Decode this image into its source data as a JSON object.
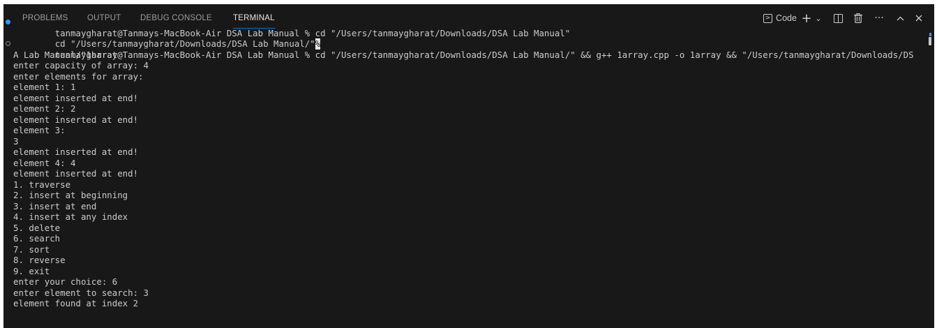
{
  "panel": {
    "tabs": [
      {
        "label": "PROBLEMS",
        "active": false
      },
      {
        "label": "OUTPUT",
        "active": false
      },
      {
        "label": "DEBUG CONSOLE",
        "active": false
      },
      {
        "label": "TERMINAL",
        "active": true
      }
    ],
    "actions": {
      "terminal_label": "Code",
      "new_terminal_icon": "plus-icon",
      "dropdown_icon": "chevron-down-icon",
      "split_icon": "split-terminal-icon",
      "kill_icon": "trash-icon",
      "more_icon": "ellipsis-icon",
      "maximize_icon": "chevron-up-icon",
      "close_icon": "close-icon"
    }
  },
  "terminal": {
    "lines": [
      "tanmaygharat@Tanmays-MacBook-Air DSA Lab Manual % cd \"/Users/tanmaygharat/Downloads/DSA Lab Manual\"",
      "cd \"/Users/tanmaygharat/Downloads/DSA Lab Manual/\"",
      "tanmaygharat@Tanmays-MacBook-Air DSA Lab Manual % cd \"/Users/tanmaygharat/Downloads/DSA Lab Manual/\" && g++ 1array.cpp -o 1array && \"/Users/tanmaygharat/Downloads/DS",
      "A Lab Manual/\"1array",
      "enter capacity of array: 4",
      "enter elements for array:",
      "element 1: 1",
      "element inserted at end!",
      "element 2: 2",
      "element inserted at end!",
      "element 3:",
      "3",
      "element inserted at end!",
      "element 4: 4",
      "element inserted at end!",
      "1. traverse",
      "2. insert at beginning",
      "3. insert at end",
      "4. insert at any index",
      "5. delete",
      "6. search",
      "7. sort",
      "8. reverse",
      "9. exit",
      "enter your choice: 6",
      "enter element to search: 3",
      "element found at index 2"
    ],
    "cursor_char": "%",
    "colors": {
      "background": "#181818",
      "text": "#cccccc",
      "success_dot": "#3794ff",
      "active_tab_underline": "#0078d4"
    }
  }
}
